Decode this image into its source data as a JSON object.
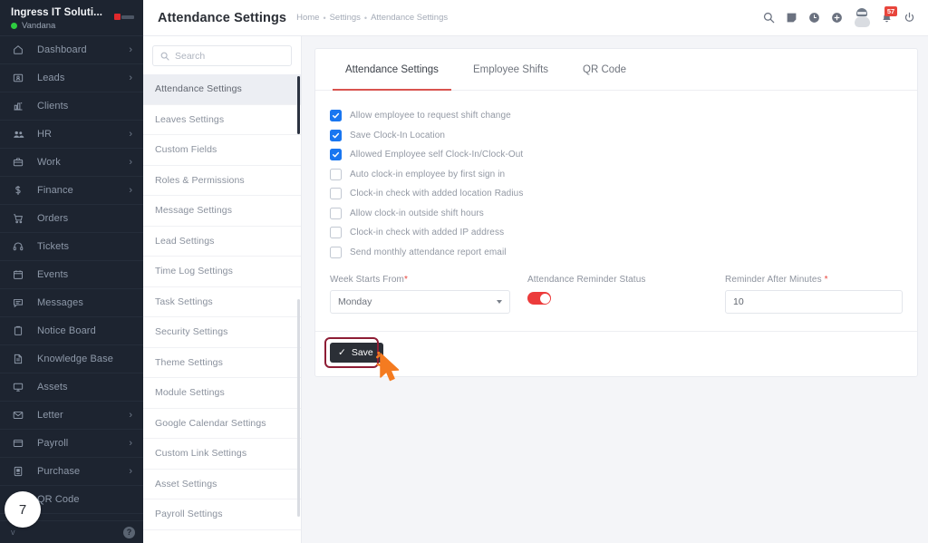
{
  "sidebar": {
    "brand_name": "Ingress IT Soluti...",
    "user_name": "Vandana",
    "items": [
      {
        "label": "Dashboard",
        "icon": "home-icon",
        "caret": "›"
      },
      {
        "label": "Leads",
        "icon": "leads-icon",
        "caret": "›"
      },
      {
        "label": "Clients",
        "icon": "clients-icon",
        "caret": ""
      },
      {
        "label": "HR",
        "icon": "hr-icon",
        "caret": "›"
      },
      {
        "label": "Work",
        "icon": "work-icon",
        "caret": "›"
      },
      {
        "label": "Finance",
        "icon": "finance-icon",
        "caret": "›"
      },
      {
        "label": "Orders",
        "icon": "orders-icon",
        "caret": ""
      },
      {
        "label": "Tickets",
        "icon": "tickets-icon",
        "caret": ""
      },
      {
        "label": "Events",
        "icon": "events-icon",
        "caret": ""
      },
      {
        "label": "Messages",
        "icon": "messages-icon",
        "caret": ""
      },
      {
        "label": "Notice Board",
        "icon": "notice-board-icon",
        "caret": ""
      },
      {
        "label": "Knowledge Base",
        "icon": "knowledge-base-icon",
        "caret": ""
      },
      {
        "label": "Assets",
        "icon": "assets-icon",
        "caret": ""
      },
      {
        "label": "Letter",
        "icon": "letter-icon",
        "caret": "›"
      },
      {
        "label": "Payroll",
        "icon": "payroll-icon",
        "caret": "›"
      },
      {
        "label": "Purchase",
        "icon": "purchase-icon",
        "caret": "›"
      },
      {
        "label": "QR Code",
        "icon": "qr-code-icon",
        "caret": ""
      }
    ],
    "footer_text": "v",
    "help_label": "?",
    "step_badge": "7"
  },
  "topbar": {
    "title": "Attendance Settings",
    "breadcrumb": [
      "Home",
      "Settings",
      "Attendance Settings"
    ],
    "separator": "•",
    "icons": [
      "search-icon",
      "note-icon",
      "clock-icon",
      "plus-circle-icon"
    ],
    "notification_count": "57"
  },
  "settings_panel": {
    "search_placeholder": "Search",
    "search_value": "",
    "items": [
      "Attendance Settings",
      "Leaves Settings",
      "Custom Fields",
      "Roles & Permissions",
      "Message Settings",
      "Lead Settings",
      "Time Log Settings",
      "Task Settings",
      "Security Settings",
      "Theme Settings",
      "Module Settings",
      "Google Calendar Settings",
      "Custom Link Settings",
      "Asset Settings",
      "Payroll Settings"
    ],
    "active_index": 0
  },
  "card": {
    "tabs": [
      {
        "label": "Attendance Settings",
        "active": true
      },
      {
        "label": "Employee Shifts",
        "active": false
      },
      {
        "label": "QR Code",
        "active": false
      }
    ],
    "checkboxes": [
      {
        "label": "Allow employee to request shift change",
        "checked": true
      },
      {
        "label": "Save Clock-In Location",
        "checked": true
      },
      {
        "label": "Allowed Employee self Clock-In/Clock-Out",
        "checked": true
      },
      {
        "label": "Auto clock-in employee by first sign in",
        "checked": false
      },
      {
        "label": "Clock-in check with added location Radius",
        "checked": false
      },
      {
        "label": "Allow clock-in outside shift hours",
        "checked": false
      },
      {
        "label": "Clock-in check with added IP address",
        "checked": false
      },
      {
        "label": "Send monthly attendance report email",
        "checked": false
      }
    ],
    "fields": {
      "week_starts_label": "Week Starts From",
      "week_starts_required": "*",
      "week_starts_value": "Monday",
      "reminder_status_label": "Attendance Reminder Status",
      "reminder_status_on": true,
      "reminder_minutes_label": "Reminder After Minutes",
      "reminder_minutes_required": "*",
      "reminder_minutes_value": "10"
    },
    "save_label": "Save",
    "save_check": "✓"
  },
  "colors": {
    "accent_red": "#d9534f",
    "checkbox_blue": "#1976f0",
    "toggle_red": "#ec3b3b",
    "sidebar_bg": "#1d2430",
    "highlight_border": "#8e1d35",
    "cursor_orange": "#f47b20"
  }
}
